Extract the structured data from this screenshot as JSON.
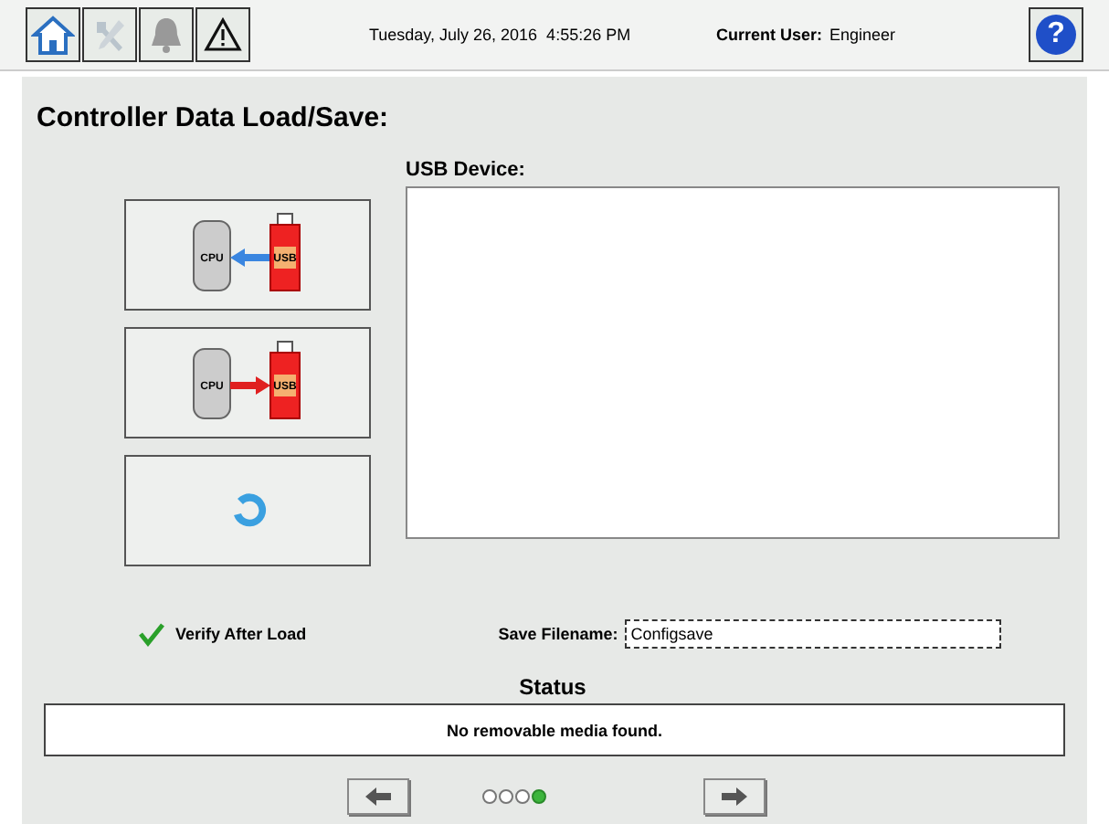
{
  "header": {
    "datetime": "Tuesday, July 26, 2016  4:55:26 PM",
    "user_label": "Current User:",
    "user": "Engineer",
    "help": "?"
  },
  "title": "Controller Data Load/Save:",
  "actions": [
    {
      "kind": "load",
      "cpu": "CPU",
      "usb": "USB"
    },
    {
      "kind": "save",
      "cpu": "CPU",
      "usb": "USB"
    },
    {
      "kind": "refresh"
    }
  ],
  "usb_device": {
    "label": "USB Device:"
  },
  "verify": {
    "label": "Verify After Load",
    "checked": true
  },
  "save_filename": {
    "label": "Save Filename:",
    "value": "Configsave"
  },
  "status": {
    "label": "Status",
    "message": "No removable media found."
  },
  "pages": [
    {
      "selected": false
    },
    {
      "selected": false
    },
    {
      "selected": false
    },
    {
      "selected": true
    }
  ]
}
